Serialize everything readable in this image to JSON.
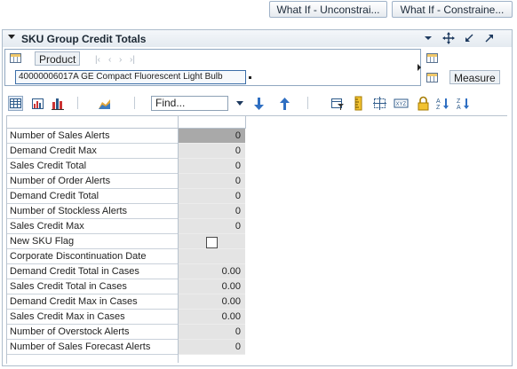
{
  "top_buttons": {
    "what_if_unconstrained": "What If - Unconstrai...",
    "what_if_constrained": "What If - Constraine..."
  },
  "panel": {
    "title": "SKU Group Credit Totals"
  },
  "pov": {
    "dimension_label": "Product",
    "member_value": "40000006017A GE Compact Fluorescent Light Bulb",
    "measure_label": "Measure"
  },
  "toolbar": {
    "find_placeholder": "Find..."
  },
  "grid": {
    "rows": [
      {
        "label": "Number of Sales Alerts",
        "value": "0"
      },
      {
        "label": "Demand Credit Max",
        "value": "0"
      },
      {
        "label": "Sales Credit Total",
        "value": "0"
      },
      {
        "label": "Number of Order Alerts",
        "value": "0"
      },
      {
        "label": "Demand Credit Total",
        "value": "0"
      },
      {
        "label": "Number of Stockless Alerts",
        "value": "0"
      },
      {
        "label": "Sales Credit Max",
        "value": "0"
      },
      {
        "label": "New SKU Flag",
        "value": ""
      },
      {
        "label": "Corporate Discontinuation Date",
        "value": ""
      },
      {
        "label": "Demand Credit Total in Cases",
        "value": "0.00"
      },
      {
        "label": "Sales Credit Total in Cases",
        "value": "0.00"
      },
      {
        "label": "Demand Credit Max in Cases",
        "value": "0.00"
      },
      {
        "label": "Sales Credit Max in Cases",
        "value": "0.00"
      },
      {
        "label": "Number of Overstock Alerts",
        "value": "0"
      },
      {
        "label": "Number of Sales Forecast Alerts",
        "value": "0"
      }
    ]
  }
}
